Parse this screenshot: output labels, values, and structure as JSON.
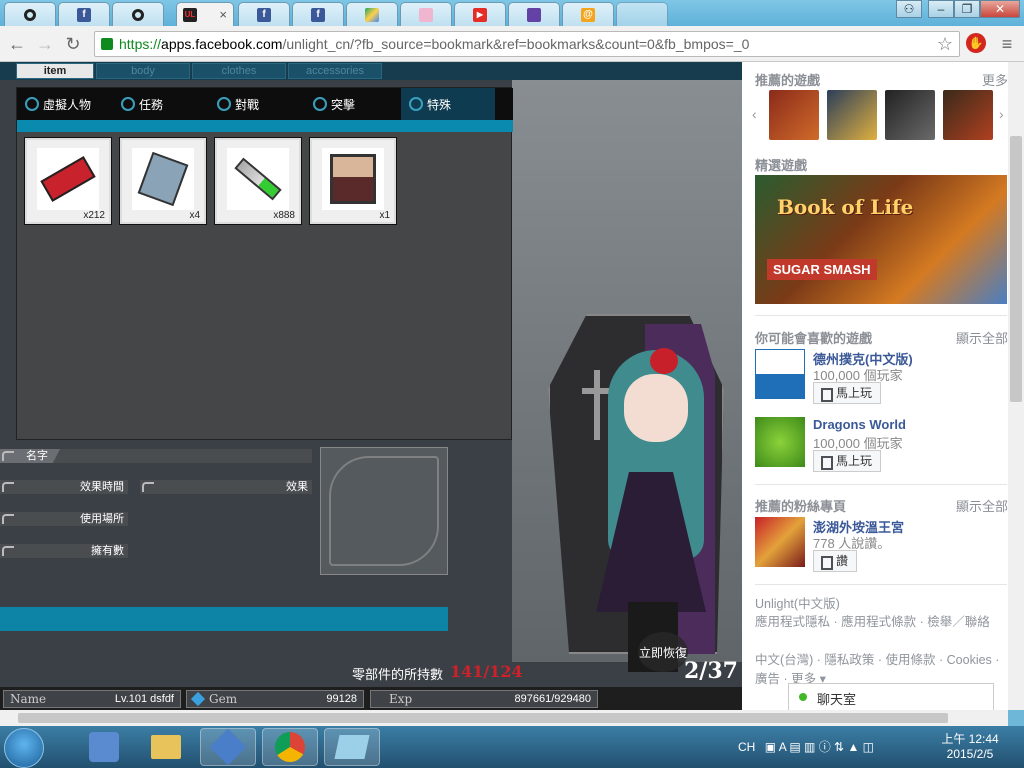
{
  "browser": {
    "tabs": [
      {
        "icon": "circle-logo-icon"
      },
      {
        "icon": "facebook-icon"
      },
      {
        "icon": "circle-logo-icon"
      },
      {
        "icon": "unlight-game-icon",
        "active": true
      },
      {
        "icon": "facebook-icon"
      },
      {
        "icon": "facebook-icon"
      },
      {
        "icon": "google-drive-icon"
      },
      {
        "icon": "anime-icon"
      },
      {
        "icon": "youtube-icon"
      },
      {
        "icon": "twitch-icon"
      },
      {
        "icon": "mail-icon"
      }
    ],
    "tab_close": "×",
    "url_scheme": "https://",
    "url_host": "apps.facebook.com",
    "url_path": "/unlight_cn/?fb_source=bookmark&ref=bookmarks&count=0&fb_bmpos=_0"
  },
  "game": {
    "top_tabs": [
      "item",
      "body",
      "clothes",
      "accessories"
    ],
    "categories": [
      "虛擬人物",
      "任務",
      "對戰",
      "突擊",
      "特殊"
    ],
    "items": [
      {
        "qty": "x212",
        "icon": "ticket-icon"
      },
      {
        "qty": "x4",
        "icon": "card-set-icon"
      },
      {
        "qty": "x888",
        "icon": "battery-icon"
      },
      {
        "qty": "x1",
        "icon": "portrait-icon"
      }
    ],
    "fields": {
      "name_label": "名字",
      "duration_label": "效果時間",
      "effect_label": "效果",
      "location_label": "使用場所",
      "owned_label": "擁有數"
    },
    "parts_label": "零部件的所持數",
    "parts_value": "141/124",
    "restore_label": "立即恢復",
    "ap_counter": "2/37",
    "status": {
      "name_label": "Name",
      "name_value": "Lv.101 dsfdf",
      "gem_label": "Gem",
      "gem_value": "99128",
      "exp_label": "Exp",
      "exp_value": "897661/929480"
    }
  },
  "sidebar": {
    "recommended_title": "推薦的遊戲",
    "more_label": "更多",
    "featured_title": "精選遊戲",
    "banner_title": "Book of Life",
    "banner_subtitle": "SUGAR SMASH",
    "may_like_title": "你可能會喜歡的遊戲",
    "show_all_1": "顯示全部",
    "games": [
      {
        "name": "德州撲克(中文版)",
        "players": "100,000 個玩家",
        "play_label": "馬上玩"
      },
      {
        "name": "Dragons World",
        "players": "100,000 個玩家",
        "play_label": "馬上玩"
      }
    ],
    "fanpage_title": "推薦的粉絲專頁",
    "show_all_2": "顯示全部",
    "page_name": "澎湖外垵溫王宮",
    "page_sub": "778 人說讚。",
    "like_label": "讚",
    "footer_line1": "Unlight(中文版)",
    "footer_line2": "應用程式隱私 · 應用程式條款 · 檢舉／聯絡",
    "footer_line3": "中文(台灣) · 隱私政策 · 使用條款 · Cookies · 廣告 · 更多 ▾",
    "chat_label": "聊天室"
  },
  "taskbar": {
    "ime": "CH",
    "time": "上午 12:44",
    "date": "2015/2/5"
  },
  "colors": {
    "accent": "#0d84a6",
    "fb_blue": "#3b5998",
    "parts_red": "#d2202a"
  }
}
